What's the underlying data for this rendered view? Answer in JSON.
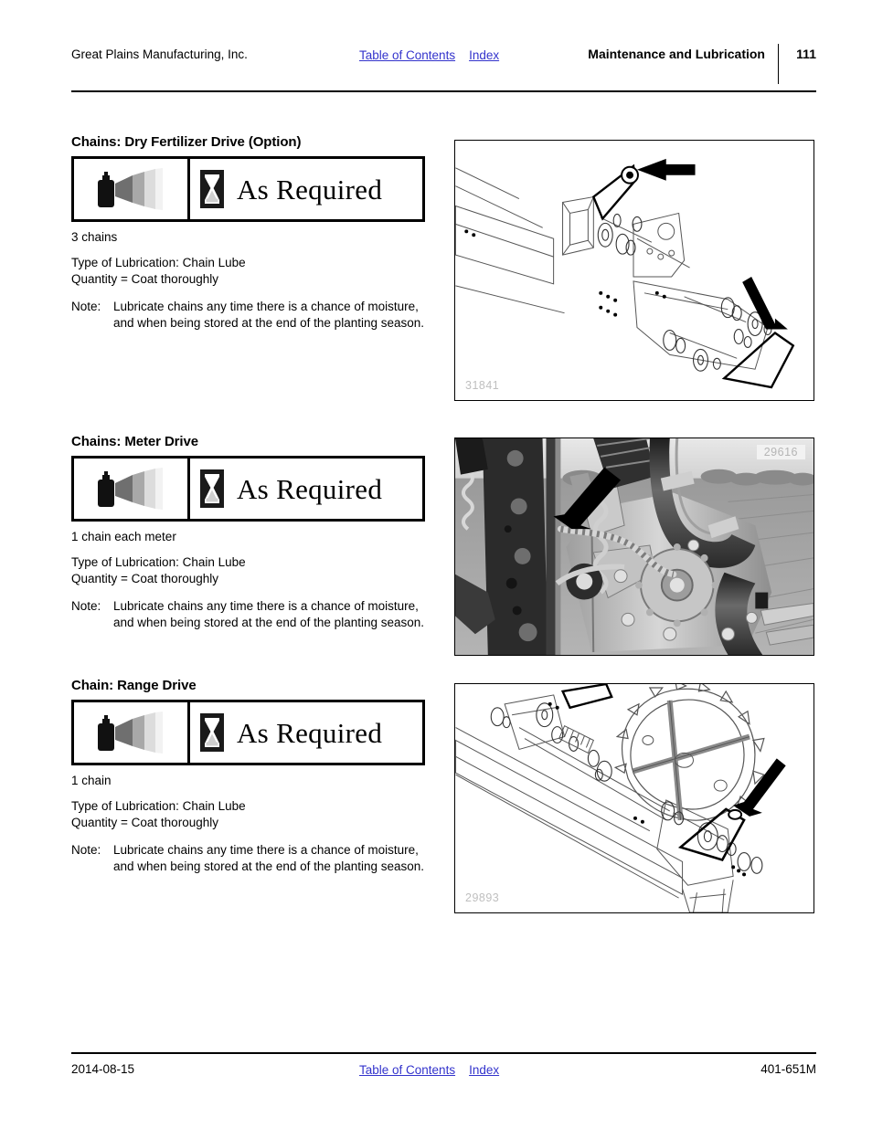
{
  "header": {
    "company": "Great Plains Manufacturing, Inc.",
    "toc_link": "Table of Contents",
    "index_link": "Index",
    "chapter": "Maintenance and Lubrication",
    "page_number": "111"
  },
  "footer": {
    "date": "2014-08-15",
    "toc_link": "Table of Contents",
    "index_link": "Index",
    "doc_code": "401-651M"
  },
  "colors": {
    "link": "#3333cc",
    "rule": "#000000",
    "figure_id": "#bfbfbf"
  },
  "icons": {
    "spray_can": "spray-can-icon",
    "hourglass": "hourglass-icon"
  },
  "sections": [
    {
      "title": "Chains: Dry Fertilizer Drive (Option)",
      "frequency": "As Required",
      "count": "3 chains",
      "lubrication_type": "Type of Lubrication: Chain Lube",
      "quantity": "Quantity = Coat thoroughly",
      "note_label": "Note:",
      "note_text": "Lubricate chains any time there is a chance of moisture, and when being stored at the end of the planting season.",
      "figure_id": "31841",
      "figure_kind": "line-drawing",
      "figure_id_position": "bottom-left"
    },
    {
      "title": "Chains: Meter Drive",
      "frequency": "As Required",
      "count": "1 chain each meter",
      "lubrication_type": "Type of Lubrication: Chain Lube",
      "quantity": "Quantity = Coat thoroughly",
      "note_label": "Note:",
      "note_text": "Lubricate chains any time there is a chance of moisture, and when being stored at the end of the planting season.",
      "figure_id": "29616",
      "figure_kind": "photograph",
      "figure_id_position": "top-right"
    },
    {
      "title": "Chain: Range Drive",
      "frequency": "As Required",
      "count": "1 chain",
      "lubrication_type": "Type of Lubrication: Chain Lube",
      "quantity": "Quantity = Coat thoroughly",
      "note_label": "Note:",
      "note_text": "Lubricate chains any time there is a chance of moisture, and when being stored at the end of the planting season.",
      "figure_id": "29893",
      "figure_kind": "line-drawing",
      "figure_id_position": "bottom-left"
    }
  ]
}
